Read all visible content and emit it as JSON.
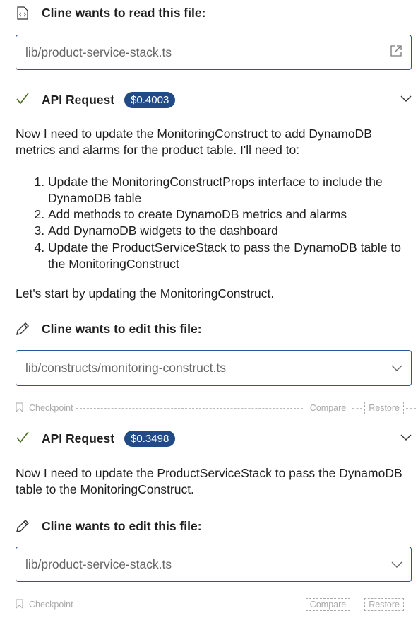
{
  "read_file": {
    "title": "Cline wants to read this file:",
    "path": "lib/product-service-stack.ts"
  },
  "api1": {
    "title": "API Request",
    "cost": "$0.4003"
  },
  "message1": {
    "intro": "Now I need to update the MonitoringConstruct to add DynamoDB metrics and alarms for the product table. I'll need to:",
    "steps": [
      "Update the MonitoringConstructProps interface to include the DynamoDB table",
      "Add methods to create DynamoDB metrics and alarms",
      "Add DynamoDB widgets to the dashboard",
      "Update the ProductServiceStack to pass the DynamoDB table to the MonitoringConstruct"
    ],
    "outro": "Let's start by updating the MonitoringConstruct."
  },
  "edit1": {
    "title": "Cline wants to edit this file:",
    "path": "lib/constructs/monitoring-construct.ts"
  },
  "checkpoint1": {
    "label": "Checkpoint",
    "compare": "Compare",
    "restore": "Restore"
  },
  "api2": {
    "title": "API Request",
    "cost": "$0.3498"
  },
  "message2": {
    "text": "Now I need to update the ProductServiceStack to pass the DynamoDB table to the MonitoringConstruct."
  },
  "edit2": {
    "title": "Cline wants to edit this file:",
    "path": "lib/product-service-stack.ts"
  },
  "checkpoint2": {
    "label": "Checkpoint",
    "compare": "Compare",
    "restore": "Restore"
  },
  "colors": {
    "accent": "#214a87",
    "border": "#2b5597",
    "check": "#4a6a1e"
  }
}
